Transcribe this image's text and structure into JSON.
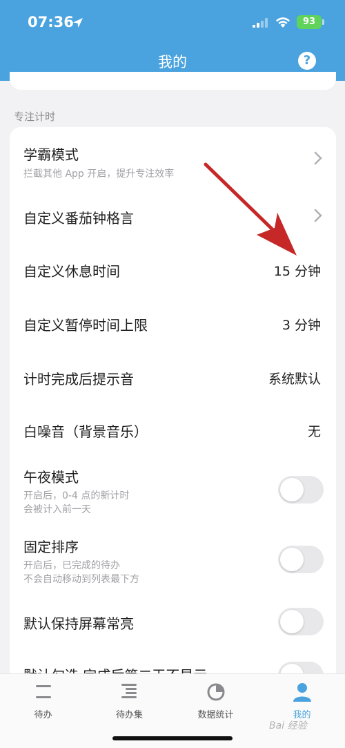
{
  "status_bar": {
    "time": "07:36",
    "battery": "93"
  },
  "header": {
    "title": "我的",
    "help_icon": "question-circle-icon"
  },
  "section": {
    "label": "专注计时"
  },
  "settings": {
    "study_mode": {
      "title": "学霸模式",
      "subtitle": "拦截其他 App 开启，提升专注效率"
    },
    "pomodoro_quote": {
      "title": "自定义番茄钟格言"
    },
    "rest_time": {
      "title": "自定义休息时间",
      "value": "15 分钟"
    },
    "pause_limit": {
      "title": "自定义暂停时间上限",
      "value": "3 分钟"
    },
    "finish_sound": {
      "title": "计时完成后提示音",
      "value": "系统默认"
    },
    "white_noise": {
      "title": "白噪音（背景音乐）",
      "value": "无"
    },
    "midnight_mode": {
      "title": "午夜模式",
      "subtitle_1": "开启后，0-4 点的新计时",
      "subtitle_2": "会被计入前一天",
      "enabled": false
    },
    "fixed_sort": {
      "title": "固定排序",
      "subtitle_1": "开启后，已完成的待办",
      "subtitle_2": "不会自动移动到列表最下方",
      "enabled": false
    },
    "keep_screen_on": {
      "title": "默认保持屏幕常亮",
      "enabled": false
    },
    "hide_next_day": {
      "title": "默认勾选 完成后第二天不显示",
      "enabled": false
    }
  },
  "tabs": [
    {
      "label": "待办",
      "icon": "list-icon"
    },
    {
      "label": "待办集",
      "icon": "list-collection-icon"
    },
    {
      "label": "数据统计",
      "icon": "pie-chart-icon"
    },
    {
      "label": "我的",
      "icon": "person-icon",
      "active": true
    }
  ],
  "colors": {
    "header": "#4aa3df",
    "accent": "#4aa3df",
    "battery": "#5fd35a",
    "arrow": "#d32f2f"
  },
  "watermark": "Bai 经验"
}
